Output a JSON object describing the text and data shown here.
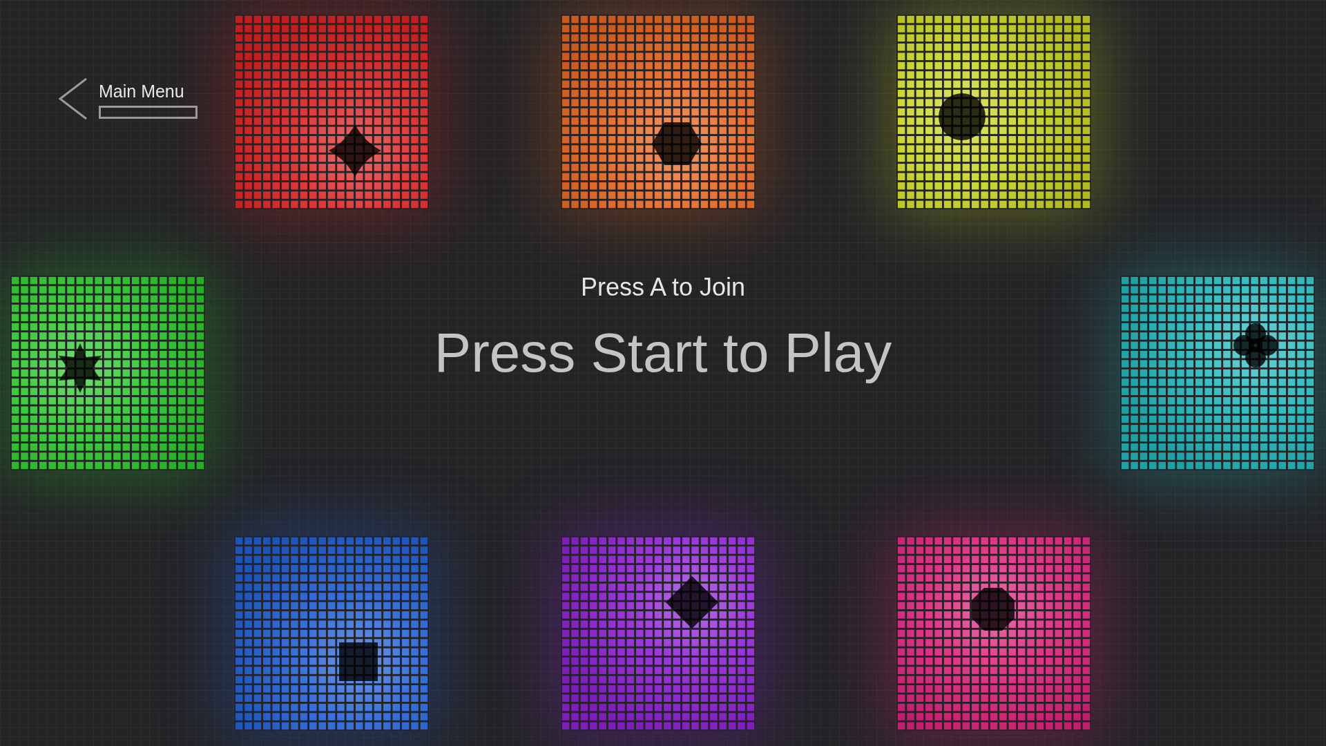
{
  "main_menu": {
    "label": "Main Menu"
  },
  "join_prompt": "Press A to Join",
  "start_prompt": "Press Start to Play",
  "players": [
    {
      "kind": "star4",
      "color": "#e02020"
    },
    {
      "kind": "hexagon",
      "color": "#e8641c"
    },
    {
      "kind": "circle",
      "color": "#c8d41c"
    },
    {
      "kind": "star6",
      "color": "#28c828"
    },
    {
      "kind": "club",
      "color": "#20b8bc"
    },
    {
      "kind": "square",
      "color": "#2060d8"
    },
    {
      "kind": "diamond",
      "color": "#9020d8"
    },
    {
      "kind": "octagon",
      "color": "#e0207c"
    }
  ]
}
